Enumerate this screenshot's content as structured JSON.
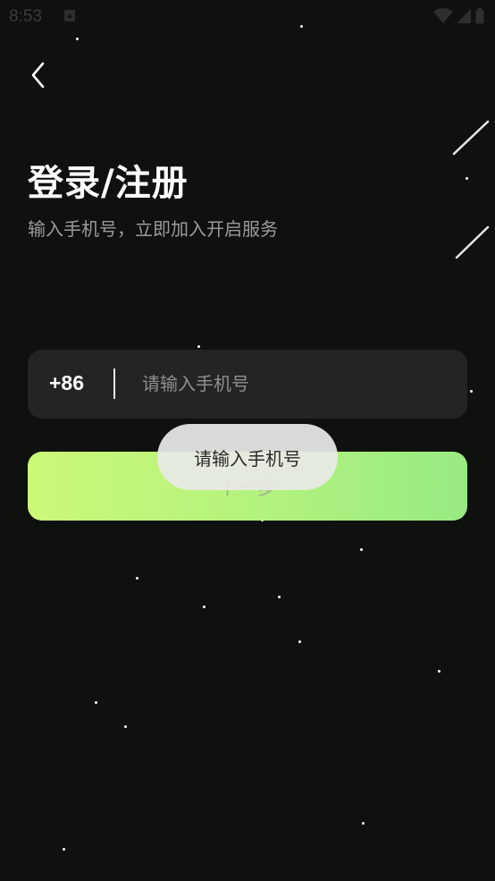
{
  "status_bar": {
    "time": "8:53",
    "notification_icon": "notification-icon",
    "wifi_icon": "wifi-icon",
    "signal_icon": "cell-signal-icon",
    "battery_icon": "battery-icon"
  },
  "nav": {
    "back_icon": "chevron-left-icon"
  },
  "header": {
    "title": "登录/注册",
    "subtitle": "输入手机号，立即加入开启服务"
  },
  "phone_field": {
    "country_code": "+86",
    "value": "",
    "placeholder": "请输入手机号"
  },
  "next_button": {
    "label": "下一步"
  },
  "toast": {
    "message": "请输入手机号"
  },
  "colors": {
    "background": "#0f110f",
    "field_background": "#232523",
    "accent_gradient_start": "#ccf877",
    "accent_gradient_end": "#97ea82",
    "subtitle": "#9a9c9a",
    "toast_background": "#e8eae6"
  }
}
